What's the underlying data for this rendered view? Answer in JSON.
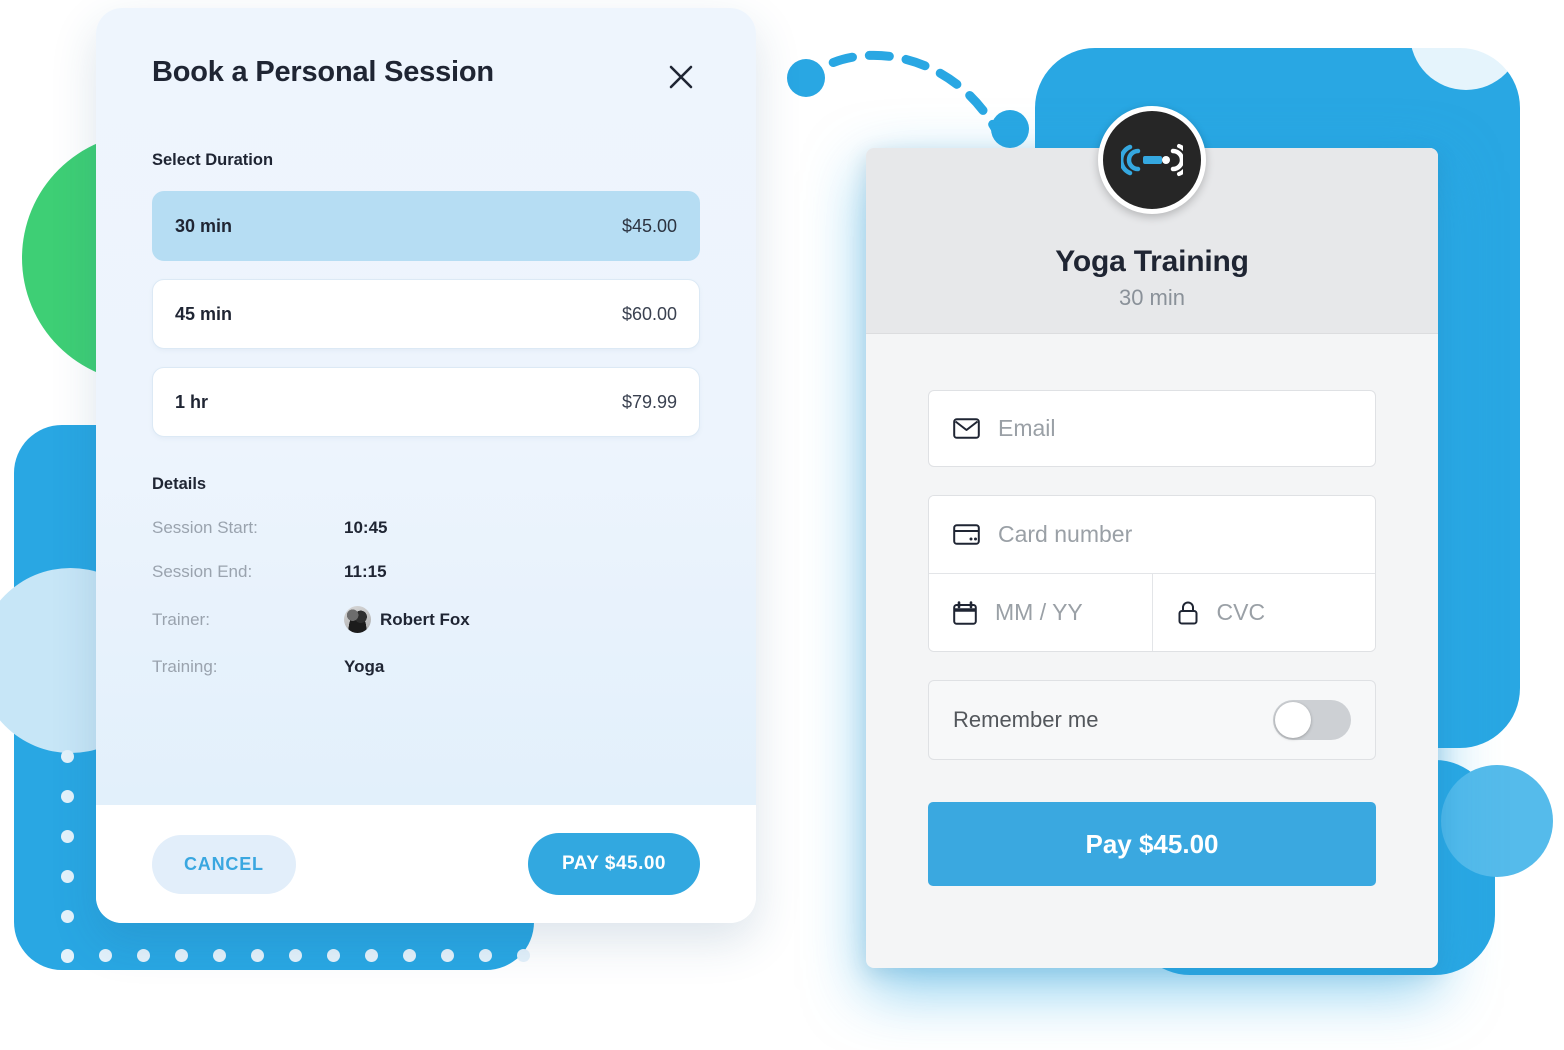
{
  "booking": {
    "title": "Book a Personal Session",
    "close_icon": "close-icon",
    "duration_section_label": "Select Duration",
    "durations": [
      {
        "label": "30 min",
        "price": "$45.00",
        "selected": true
      },
      {
        "label": "45 min",
        "price": "$60.00",
        "selected": false
      },
      {
        "label": "1 hr",
        "price": "$79.99",
        "selected": false
      }
    ],
    "details_label": "Details",
    "details": [
      {
        "key": "Session Start:",
        "value": "10:45"
      },
      {
        "key": "Session End:",
        "value": "11:15"
      },
      {
        "key": "Trainer:",
        "value": "Robert Fox"
      },
      {
        "key": "Training:",
        "value": "Yoga"
      }
    ],
    "cancel_label": "CANCEL",
    "pay_label": "PAY $45.00"
  },
  "checkout": {
    "logo_icon": "dumbbell-icon",
    "title": "Yoga Training",
    "subtitle": "30 min",
    "email": {
      "placeholder": "Email",
      "value": "",
      "icon": "envelope-icon"
    },
    "card_number": {
      "placeholder": "Card number",
      "value": "",
      "icon": "credit-card-icon"
    },
    "expiry": {
      "placeholder": "MM / YY",
      "value": "",
      "icon": "calendar-icon"
    },
    "cvc": {
      "placeholder": "CVC",
      "value": "",
      "icon": "lock-icon"
    },
    "remember_label": "Remember me",
    "remember_on": false,
    "pay_label": "Pay $45.00"
  },
  "colors": {
    "brand_blue": "#29a7e3",
    "button_blue": "#3aa8e0",
    "selected_option": "#b6ddf3",
    "green": "#3ecf75",
    "light_blue": "#c7e6f7",
    "card_bg": "#f4f5f6",
    "logo_dark": "#262626"
  }
}
